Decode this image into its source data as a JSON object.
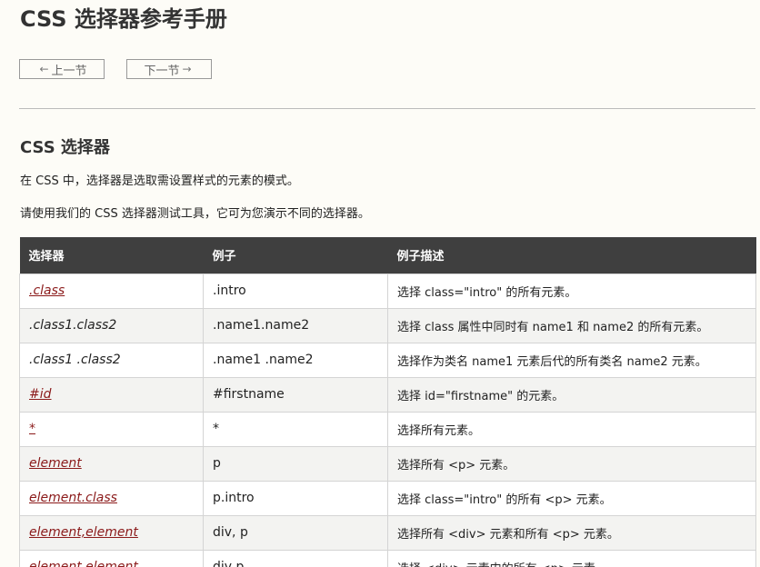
{
  "page": {
    "title": "CSS 选择器参考手册",
    "prev_label": "上一节",
    "next_label": "下一节",
    "section_title": "CSS 选择器",
    "para1": "在 CSS 中，选择器是选取需设置样式的元素的模式。",
    "para2": "请使用我们的 CSS 选择器测试工具，它可为您演示不同的选择器。"
  },
  "icons": {
    "prev": "arrow-left-icon",
    "next": "arrow-right-icon"
  },
  "table": {
    "headers": [
      "选择器",
      "例子",
      "例子描述"
    ],
    "rows": [
      {
        "selector": ".class",
        "link": true,
        "example": ".intro",
        "desc": "选择 class=\"intro\" 的所有元素。"
      },
      {
        "selector": ".class1.class2",
        "link": false,
        "example": ".name1.name2",
        "desc": "选择 class 属性中同时有 name1 和 name2 的所有元素。"
      },
      {
        "selector": ".class1 .class2",
        "link": false,
        "example": ".name1 .name2",
        "desc": "选择作为类名 name1 元素后代的所有类名 name2 元素。"
      },
      {
        "selector": "#id",
        "link": true,
        "example": "#firstname",
        "desc": "选择 id=\"firstname\" 的元素。"
      },
      {
        "selector": "*",
        "link": true,
        "example": "*",
        "desc": "选择所有元素。"
      },
      {
        "selector": "element",
        "link": true,
        "example": "p",
        "desc": "选择所有 <p> 元素。"
      },
      {
        "selector": "element.class",
        "link": true,
        "example": "p.intro",
        "desc": "选择 class=\"intro\" 的所有 <p> 元素。"
      },
      {
        "selector": "element,element",
        "link": true,
        "example": "div, p",
        "desc": "选择所有 <div> 元素和所有 <p> 元素。"
      },
      {
        "selector": "element element",
        "link": true,
        "example": "div p",
        "desc": "选择 <div> 元素内的所有 <p> 元素。"
      }
    ]
  }
}
